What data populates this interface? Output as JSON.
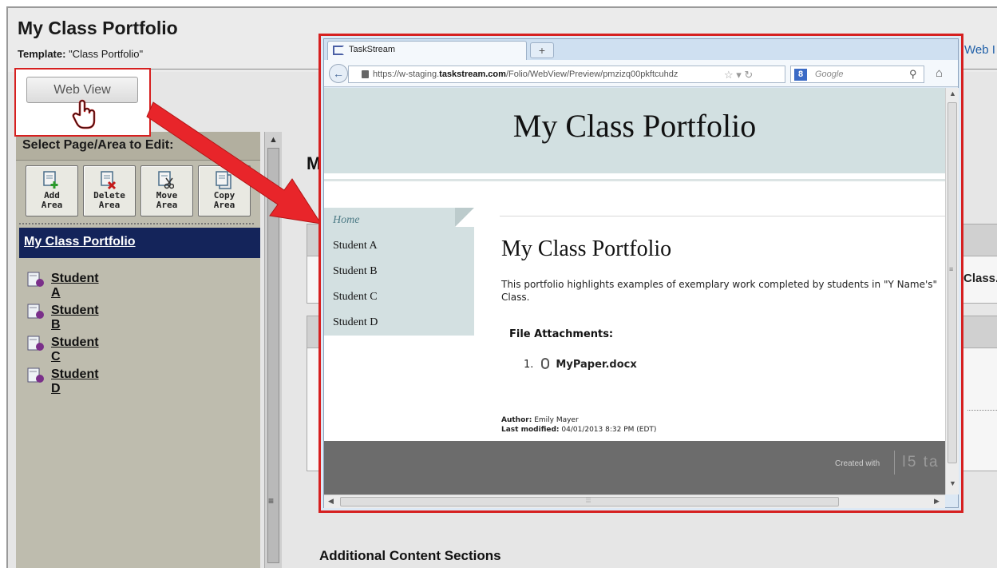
{
  "app": {
    "title": "My Class Portfolio",
    "template_label": "Template:",
    "template_value": "\"Class Portfolio\"",
    "web_link_cut": "Web I"
  },
  "web_view_button": {
    "label": "Web View"
  },
  "sidebar": {
    "heading": "Select Page/Area to Edit:",
    "tools": [
      {
        "label": "Add\nArea",
        "icon": "add-area-icon"
      },
      {
        "label": "Delete\nArea",
        "icon": "delete-area-icon"
      },
      {
        "label": "Move\nArea",
        "icon": "move-area-icon"
      },
      {
        "label": "Copy\nArea",
        "icon": "copy-area-icon"
      }
    ],
    "active_item": "My Class Portfolio",
    "items": [
      "Student A",
      "Student B",
      "Student C",
      "Student D"
    ]
  },
  "main": {
    "heading_partial": "M",
    "class_cut": "Class.",
    "additional_sections": "Additional Content Sections"
  },
  "browser": {
    "tab_title": "TaskStream",
    "new_tab_label": "+",
    "url_prefix": "https://w-staging.",
    "url_domain": "taskstream.com",
    "url_path": "/Folio/WebView/Preview/pmzizq00pkftcuhdz",
    "search_engine_badge": "8",
    "search_placeholder": "Google",
    "page": {
      "banner_title": "My Class Portfolio",
      "nav": [
        {
          "label": "Home",
          "active": true
        },
        {
          "label": "Student A",
          "active": false
        },
        {
          "label": "Student B",
          "active": false
        },
        {
          "label": "Student C",
          "active": false
        },
        {
          "label": "Student D",
          "active": false
        }
      ],
      "heading": "My Class Portfolio",
      "description": "This portfolio highlights examples of exemplary work completed by students in \"Y Name's\" Class.",
      "attachments_heading": "File Attachments:",
      "attachment_number": "1.",
      "attachment_name": "MyPaper.docx",
      "author_label": "Author:",
      "author_value": "Emily Mayer",
      "modified_label": "Last modified:",
      "modified_value": "04/01/2013 8:32 PM (EDT)",
      "footer_created": "Created with",
      "footer_logo": "ta"
    }
  },
  "colors": {
    "callout_red": "#d62020",
    "sidebar_active": "#14245a",
    "banner_teal": "#d2e0e1",
    "footer_gray": "#6c6c6c"
  }
}
